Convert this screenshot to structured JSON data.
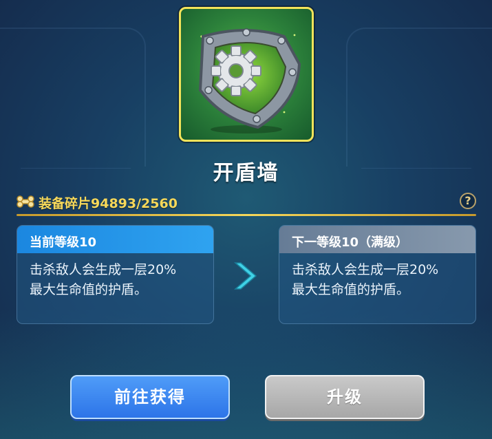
{
  "item": {
    "name": "开盾墙",
    "icon": "gear-shield-icon"
  },
  "fragments": {
    "label": "装备碎片94893/2560",
    "icon": "bone-fragment-icon",
    "help": "?"
  },
  "current_level": {
    "header": "当前等级10",
    "description_line1": "击杀敌人会生成一层20%",
    "description_line2": "最大生命值的护盾。"
  },
  "next_level": {
    "header": "下一等级10（满级）",
    "description_line1": "击杀敌人会生成一层20%",
    "description_line2": "最大生命值的护盾。"
  },
  "buttons": {
    "obtain": "前往获得",
    "upgrade": "升级"
  },
  "colors": {
    "accent_gold": "#f6d85a",
    "current_header": "#1b87e0",
    "next_header": "#7a8ea5",
    "primary_button": "#2d74e8",
    "disabled_button": "#a7a7a7"
  }
}
